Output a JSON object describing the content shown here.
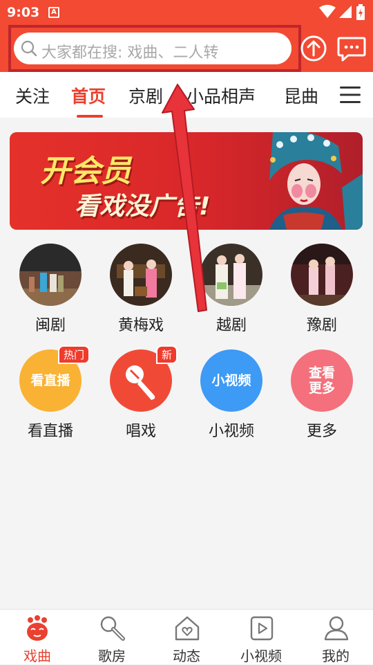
{
  "status_bar": {
    "time": "9:03",
    "notification_glyph": "A"
  },
  "search": {
    "placeholder": "大家都在搜: 戏曲、二人转"
  },
  "tabs": [
    {
      "label": "关注",
      "active": false
    },
    {
      "label": "首页",
      "active": true
    },
    {
      "label": "京剧",
      "active": false
    },
    {
      "label": "小品相声",
      "active": false
    },
    {
      "label": "昆曲",
      "active": false
    }
  ],
  "banner": {
    "line1": "开会员",
    "line2": "看戏没广告!"
  },
  "categories": [
    {
      "label": "闽剧",
      "icon": "min-opera-photo"
    },
    {
      "label": "黄梅戏",
      "icon": "huangmei-opera-photo"
    },
    {
      "label": "越剧",
      "icon": "yue-opera-photo"
    },
    {
      "label": "豫剧",
      "icon": "yu-opera-photo"
    }
  ],
  "features": [
    {
      "label": "看直播",
      "circle_text": "看直播",
      "badge": "热门",
      "color": "#f9b233"
    },
    {
      "label": "唱戏",
      "circle_text": "",
      "badge": "新",
      "color": "#f04a36"
    },
    {
      "label": "小视频",
      "circle_text": "小视频",
      "badge": "",
      "color": "#3d9af5"
    },
    {
      "label": "更多",
      "circle_text": "查看更多",
      "badge": "",
      "color": "#f3707c"
    }
  ],
  "bottom_nav": [
    {
      "label": "戏曲",
      "icon": "opera-mask-icon",
      "active": true
    },
    {
      "label": "歌房",
      "icon": "microphone-icon",
      "active": false
    },
    {
      "label": "动态",
      "icon": "home-heart-icon",
      "active": false
    },
    {
      "label": "小视频",
      "icon": "play-icon",
      "active": false
    },
    {
      "label": "我的",
      "icon": "person-icon",
      "active": false
    }
  ],
  "colors": {
    "accent": "#e8412e",
    "header_bg": "#f24a33",
    "annotation": "#c0252b"
  }
}
